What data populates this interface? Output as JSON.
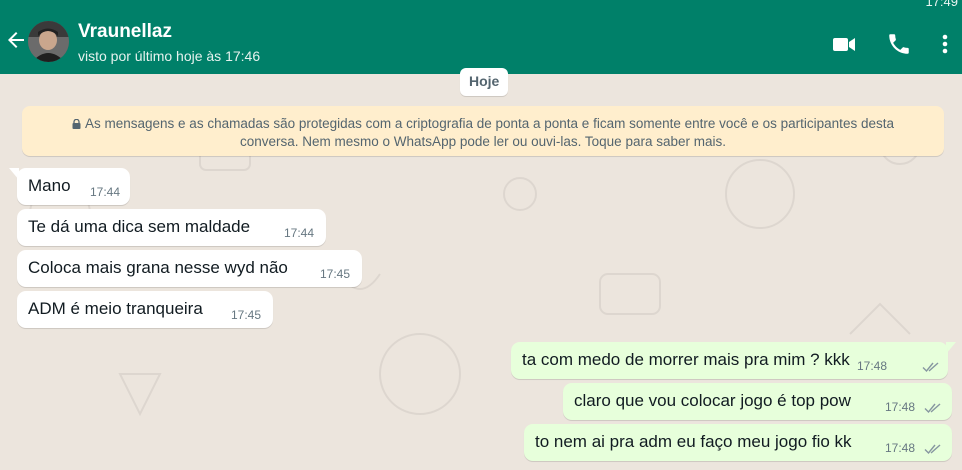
{
  "status_bar": {
    "time": "17:49"
  },
  "header": {
    "contact_name": "Vraunellaz",
    "last_seen": "visto por último hoje às 17:46",
    "bg_color": "#008069",
    "icons": [
      "arrow-back-icon",
      "video-call-icon",
      "phone-call-icon",
      "more-vert-icon"
    ]
  },
  "chat": {
    "date_label": "Hoje",
    "encryption_notice_line1": "As mensagens e as chamadas são protegidas com a criptografia de ponta a ponta e ficam somente entre você e os participantes desta",
    "encryption_notice_line2": "conversa. Nem mesmo o WhatsApp pode ler ou ouvi-las. Toque para saber mais.",
    "incoming": [
      {
        "text": "Mano",
        "time": "17:44"
      },
      {
        "text": "Te dá uma dica sem maldade",
        "time": "17:44"
      },
      {
        "text": "Coloca mais grana nesse wyd não",
        "time": "17:45"
      },
      {
        "text": "ADM é meio tranqueira",
        "time": "17:45"
      }
    ],
    "outgoing": [
      {
        "text": "ta com medo de morrer mais pra mim ? kkk",
        "time": "17:48",
        "status": "read-ticks-icon"
      },
      {
        "text": "claro que vou colocar jogo é top pow",
        "time": "17:48",
        "status": "read-ticks-icon"
      },
      {
        "text": "to nem ai pra adm eu faço meu jogo fio kk",
        "time": "17:48",
        "status": "read-ticks-icon"
      }
    ],
    "colors": {
      "wallpaper": "#ECE5DD",
      "incoming_bubble": "#FFFFFF",
      "outgoing_bubble": "#E7FFDB",
      "notice_bg": "#FFEECD"
    }
  }
}
